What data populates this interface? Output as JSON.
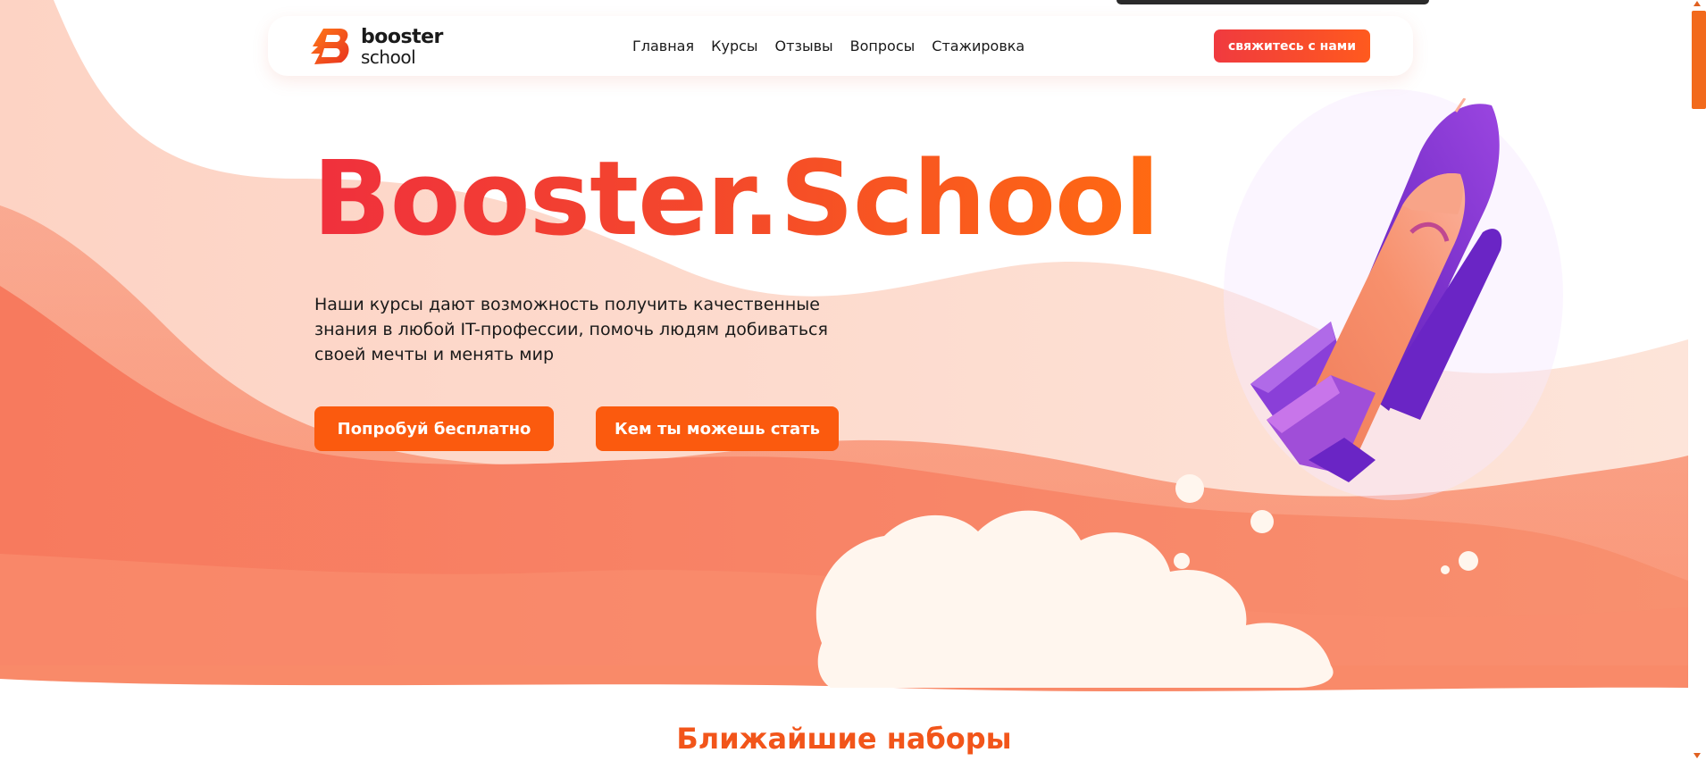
{
  "header": {
    "logo_line1": "booster",
    "logo_line2": "school",
    "nav": [
      "Главная",
      "Курсы",
      "Отзывы",
      "Вопросы",
      "Стажировка"
    ],
    "contact_label": "свяжитесь с нами"
  },
  "hero": {
    "title": "Booster.School",
    "description": "Наши курсы дают возможность получить качественные знания в любой IT-профессии, помочь людям добиваться своей мечты и менять мир",
    "try_button": "Попробуй бесплатно",
    "career_button": "Кем ты можешь стать"
  },
  "next_section": {
    "title": "Ближайшие наборы"
  },
  "icons": {
    "logo": "booster-b-logo-icon",
    "hero_image": "rocket-icon"
  },
  "colors": {
    "accent": "#fb5a0e",
    "accent_red": "#f0303d",
    "rocket_purple": "#7a2fd0",
    "background_coral": "#f78060"
  }
}
